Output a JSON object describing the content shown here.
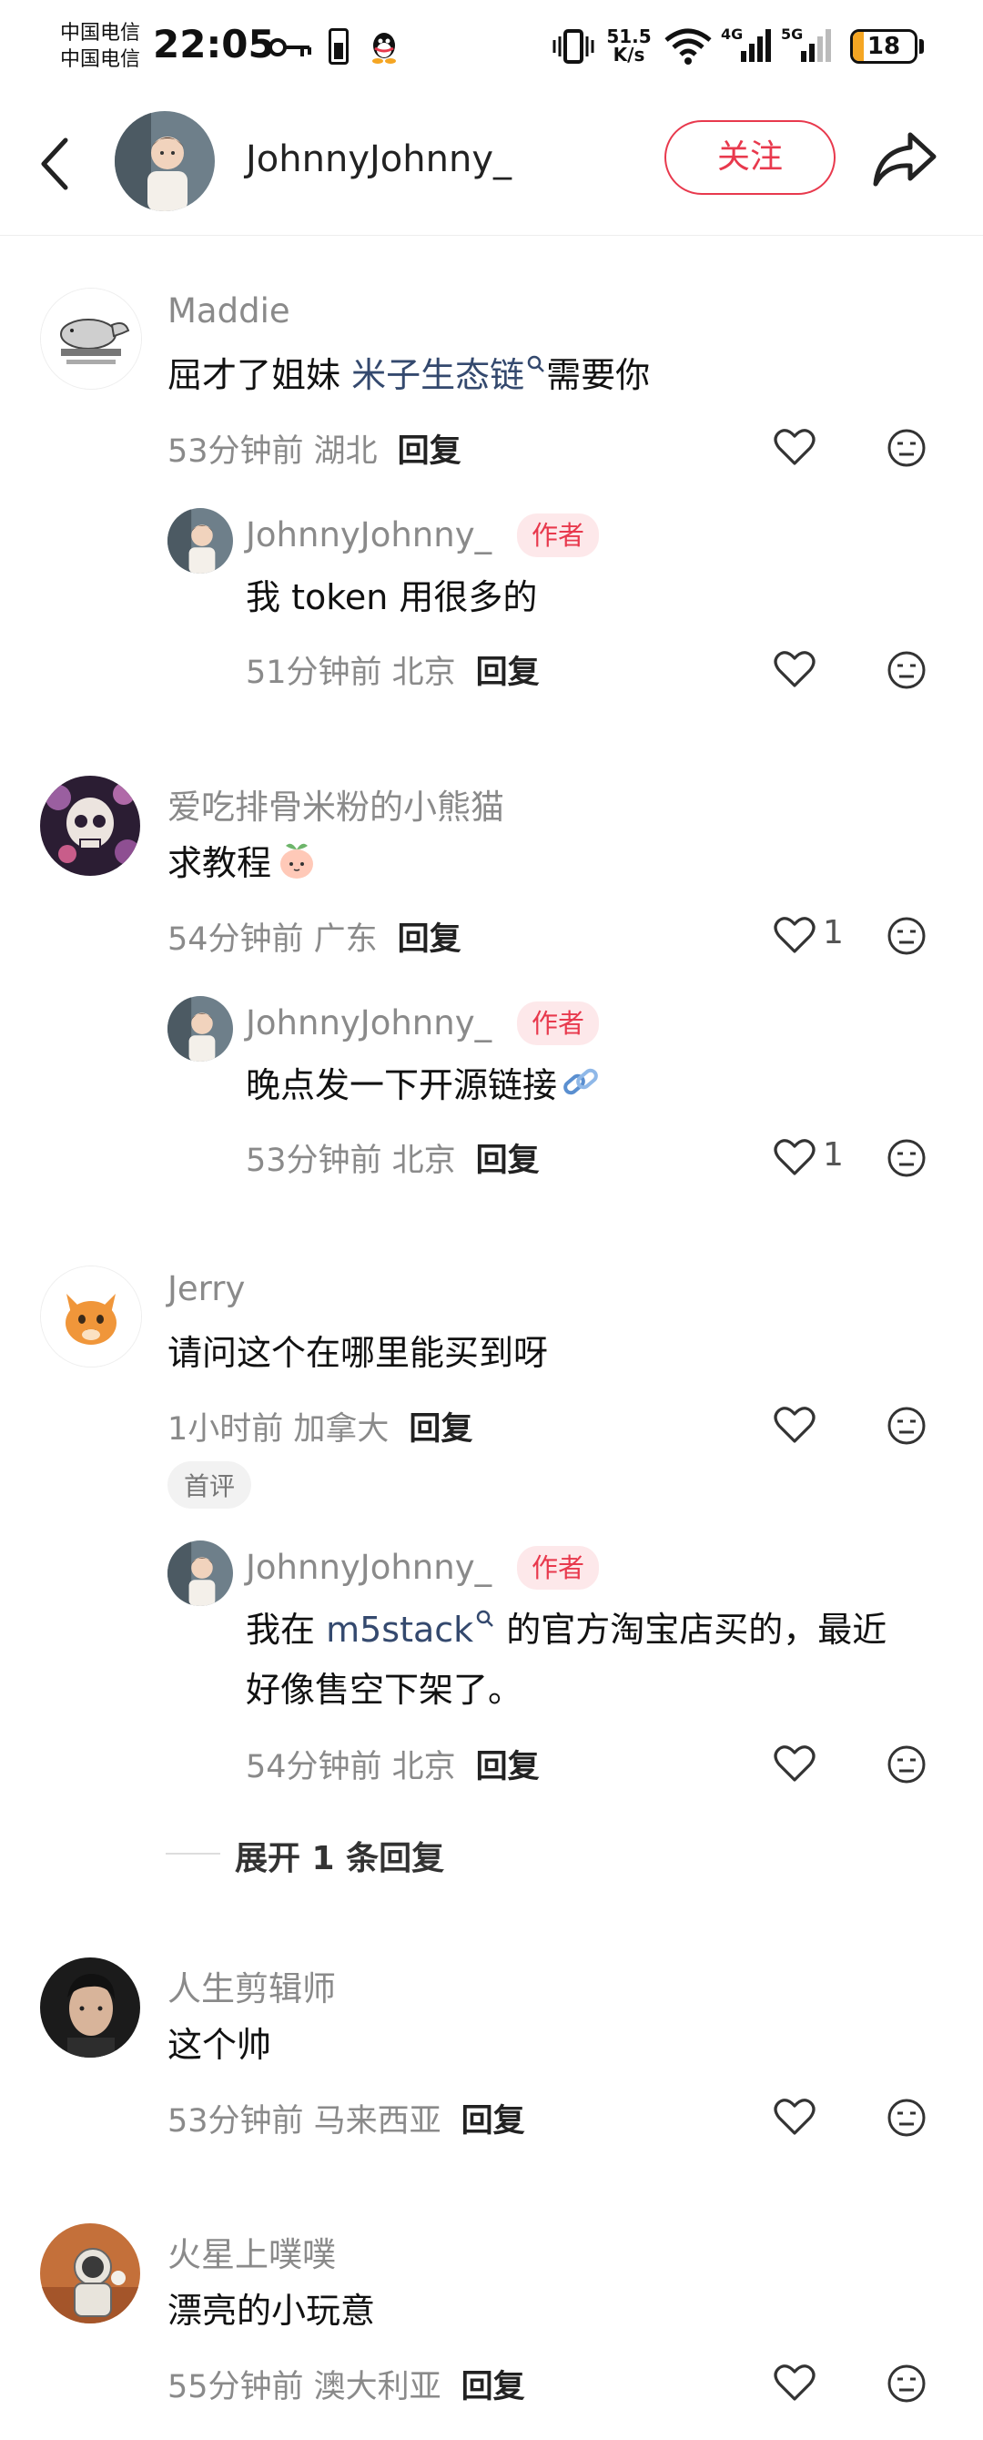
{
  "status_bar": {
    "carrier_1": "中国电信",
    "carrier_2": "中国电信",
    "time": "22:05",
    "net_speed_value": "51.5",
    "net_speed_unit": "K/s",
    "signal_1_label": "4G",
    "signal_2_label": "5G",
    "battery": "18",
    "battery_level": 0.18,
    "battery_color": "#f5a623"
  },
  "header": {
    "username": "JohnnyJohnny_",
    "follow_label": "关注",
    "accent_color": "#e8394d"
  },
  "comments": [
    {
      "user": "Maddie",
      "text_before": "屈才了姐妹 ",
      "link": "米子生态链",
      "text_after": "需要你",
      "meta": "53分钟前 湖北",
      "reply_label": "回复",
      "reply": {
        "user": "JohnnyJohnny_",
        "badge": "作者",
        "text": "我 token 用很多的",
        "meta": "51分钟前 北京",
        "reply_label": "回复"
      }
    },
    {
      "user": "爱吃排骨米粉的小熊猫",
      "text": "求教程",
      "meta": "54分钟前 广东",
      "reply_label": "回复",
      "likes": "1",
      "reply": {
        "user": "JohnnyJohnny_",
        "badge": "作者",
        "text": "晚点发一下开源链接",
        "meta": "53分钟前 北京",
        "reply_label": "回复",
        "likes": "1"
      }
    },
    {
      "user": "Jerry",
      "text": "请问这个在哪里能买到呀",
      "meta": "1小时前 加拿大",
      "reply_label": "回复",
      "tag": "首评",
      "reply": {
        "user": "JohnnyJohnny_",
        "badge": "作者",
        "text_before": "我在 ",
        "link": "m5stack",
        "text_after": " 的官方淘宝店买的，最近",
        "text_line2": "好像售空下架了。",
        "meta": "54分钟前 北京",
        "reply_label": "回复"
      },
      "expand_label": "展开 1 条回复"
    },
    {
      "user": "人生剪辑师",
      "text": "这个帅",
      "meta": "53分钟前 马来西亚",
      "reply_label": "回复"
    },
    {
      "user": "火星上噗噗",
      "text": "漂亮的小玩意",
      "meta": "55分钟前 澳大利亚",
      "reply_label": "回复"
    }
  ]
}
